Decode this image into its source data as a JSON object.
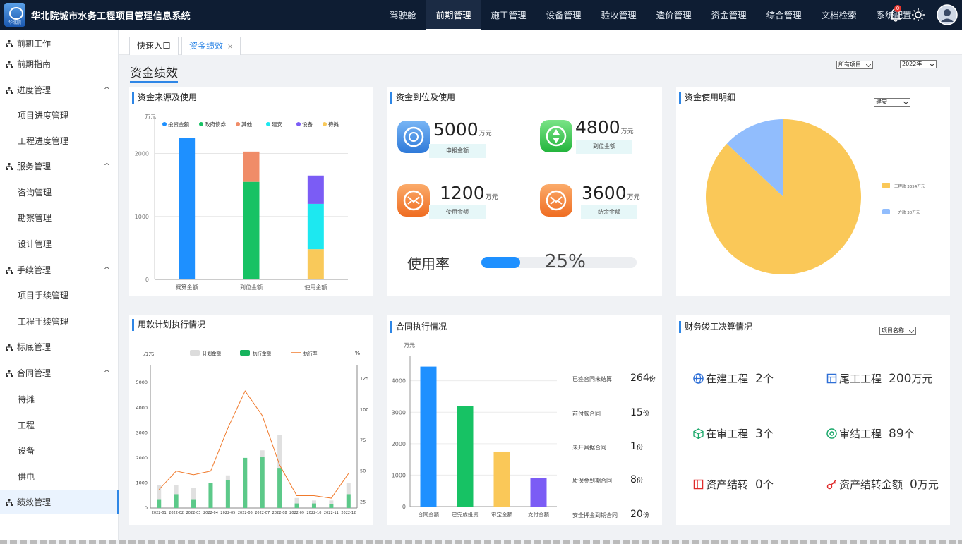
{
  "app": {
    "title": "华北院城市水务工程项目管理信息系统",
    "logo_text": "华北院"
  },
  "topnav": [
    "驾驶舱",
    "前期管理",
    "施工管理",
    "设备管理",
    "验收管理",
    "造价管理",
    "资金管理",
    "综合管理",
    "文档检索",
    "系统配置"
  ],
  "topnav_active": 1,
  "notify_count": "0",
  "sidebar": [
    {
      "label": "前期工作",
      "type": "parent",
      "chev": ""
    },
    {
      "label": "前期指南",
      "type": "parent",
      "chev": ""
    },
    {
      "label": "进度管理",
      "type": "parent",
      "chev": "^"
    },
    {
      "label": "项目进度管理",
      "type": "child"
    },
    {
      "label": "工程进度管理",
      "type": "child"
    },
    {
      "label": "服务管理",
      "type": "parent",
      "chev": "^"
    },
    {
      "label": "咨询管理",
      "type": "child"
    },
    {
      "label": "勘察管理",
      "type": "child"
    },
    {
      "label": "设计管理",
      "type": "child"
    },
    {
      "label": "手续管理",
      "type": "parent",
      "chev": "^"
    },
    {
      "label": "项目手续管理",
      "type": "child"
    },
    {
      "label": "工程手续管理",
      "type": "child"
    },
    {
      "label": "标底管理",
      "type": "parent",
      "chev": ""
    },
    {
      "label": "合同管理",
      "type": "parent",
      "chev": "^"
    },
    {
      "label": "待摊",
      "type": "child"
    },
    {
      "label": "工程",
      "type": "child"
    },
    {
      "label": "设备",
      "type": "child"
    },
    {
      "label": "供电",
      "type": "child"
    },
    {
      "label": "绩效管理",
      "type": "parent",
      "chev": "",
      "active": true
    }
  ],
  "tabs": [
    {
      "label": "快速入口",
      "close": ""
    },
    {
      "label": "资金绩效",
      "close": "×",
      "active": true
    }
  ],
  "page": {
    "title": "资金绩效",
    "filter_project": "所有项目",
    "filter_year": "2022年"
  },
  "funds_source": {
    "title": "资金来源及使用",
    "unit": "万元",
    "legend": [
      "投资金额",
      "政府债券",
      "其他",
      "建安",
      "设备",
      "待摊"
    ],
    "colors": [
      "#1e90ff",
      "#17c264",
      "#f08c68",
      "#1de8f0",
      "#7b5cf5",
      "#f9c95a"
    ],
    "chart_data": {
      "type": "bar",
      "categories": [
        "概算金额",
        "到位金额",
        "使用金额"
      ],
      "yticks": [
        0,
        1000,
        2000
      ],
      "ylim": [
        0,
        2600
      ],
      "series": [
        {
          "name": "投资金额",
          "values": [
            2250,
            0,
            0
          ]
        },
        {
          "name": "政府债券",
          "values": [
            0,
            1550,
            0
          ]
        },
        {
          "name": "其他",
          "values": [
            0,
            480,
            0
          ]
        },
        {
          "name": "待摊",
          "values": [
            0,
            0,
            480
          ]
        },
        {
          "name": "建安",
          "values": [
            0,
            0,
            720
          ]
        },
        {
          "name": "设备",
          "values": [
            0,
            0,
            450
          ]
        }
      ]
    }
  },
  "funds_arrival": {
    "title": "资金到位及使用",
    "stats": [
      {
        "value": "5000",
        "unit": "万元",
        "label": "申报金额"
      },
      {
        "value": "4800",
        "unit": "万元",
        "label": "到位金额"
      },
      {
        "value": "1200",
        "unit": "万元",
        "label": "使用金额"
      },
      {
        "value": "3600",
        "unit": "万元",
        "label": "结余金额"
      }
    ],
    "usage_label": "使用率",
    "usage_rate": "25%",
    "usage_fraction": 0.25
  },
  "funds_detail": {
    "title": "资金使用明细",
    "select": "建安",
    "chart_data": {
      "type": "pie",
      "slices": [
        {
          "name": "工程款",
          "text": "工程款 3354万元",
          "value": 0.87,
          "color": "#fac858"
        },
        {
          "name": "土方款",
          "text": "土方款 30万元",
          "value": 0.13,
          "color": "#91bdfd"
        }
      ]
    }
  },
  "payment_plan": {
    "title": "用款计划执行情况",
    "left_unit": "万元",
    "right_unit": "%",
    "legend": [
      "计划金额",
      "执行金额",
      "执行率"
    ],
    "chart_data": {
      "type": "bar",
      "categories": [
        "2022-01",
        "2022-02",
        "2022-03",
        "2022-04",
        "2022-05",
        "2022-06",
        "2022-07",
        "2022-08",
        "2022-09",
        "2022-10",
        "2022-11",
        "2022-12"
      ],
      "yticks": [
        0,
        1000,
        2000,
        3000,
        4000,
        5000
      ],
      "ylim": [
        0,
        5400
      ],
      "y2ticks": [
        25,
        50,
        75,
        100,
        125
      ],
      "y2lim": [
        20,
        130
      ],
      "series": [
        {
          "name": "计划金额",
          "values": [
            900,
            900,
            800,
            1000,
            1300,
            1200,
            2300,
            2900,
            400,
            300,
            300,
            1000
          ]
        },
        {
          "name": "执行金额",
          "values": [
            350,
            550,
            350,
            1000,
            1100,
            2000,
            2050,
            1600,
            180,
            180,
            150,
            550
          ]
        },
        {
          "name": "执行率",
          "values": [
            35,
            50,
            47,
            50,
            85,
            115,
            95,
            55,
            30,
            30,
            28,
            48
          ]
        }
      ]
    }
  },
  "contract": {
    "title": "合同执行情况",
    "unit": "万元",
    "chart_data": {
      "type": "bar",
      "categories": [
        "合同金额",
        "已完成投资",
        "审定金额",
        "支付金额"
      ],
      "values": [
        4450,
        3200,
        1750,
        900
      ],
      "colors": [
        "#1e90ff",
        "#17c264",
        "#fac858",
        "#7b5cf5"
      ],
      "yticks": [
        0,
        1000,
        2000,
        3000,
        4000
      ],
      "ylim": [
        0,
        4800
      ]
    },
    "stats": [
      {
        "label": "已签合同未结算",
        "value": "264",
        "unit": "份"
      },
      {
        "label": "前付款合同",
        "value": "15",
        "unit": "份"
      },
      {
        "label": "未开具据合同",
        "value": "1",
        "unit": "份"
      },
      {
        "label": "质保金到期合同",
        "value": "8",
        "unit": "份"
      },
      {
        "label": "安全押金到期合同",
        "value": "20",
        "unit": "份"
      }
    ]
  },
  "final_accounts": {
    "title": "财务竣工决算情况",
    "select": "项目名称",
    "items": [
      {
        "label": "在建工程",
        "value": "2",
        "unit": "个",
        "icon": "globe-icon",
        "color": "#2e6fd6"
      },
      {
        "label": "尾工工程",
        "value": "200",
        "unit": "万元",
        "icon": "layout-icon",
        "color": "#2e6fd6"
      },
      {
        "label": "在审工程",
        "value": "3",
        "unit": "个",
        "icon": "cube-icon",
        "color": "#1aa86a"
      },
      {
        "label": "审结工程",
        "value": "89",
        "unit": "个",
        "icon": "target-icon",
        "color": "#1aa86a"
      },
      {
        "label": "资产结转",
        "value": "0",
        "unit": "个",
        "icon": "book-icon",
        "color": "#e02b2b"
      },
      {
        "label": "资产结转金额",
        "value": "0",
        "unit": "万元",
        "icon": "key-icon",
        "color": "#e02b2b"
      }
    ]
  }
}
